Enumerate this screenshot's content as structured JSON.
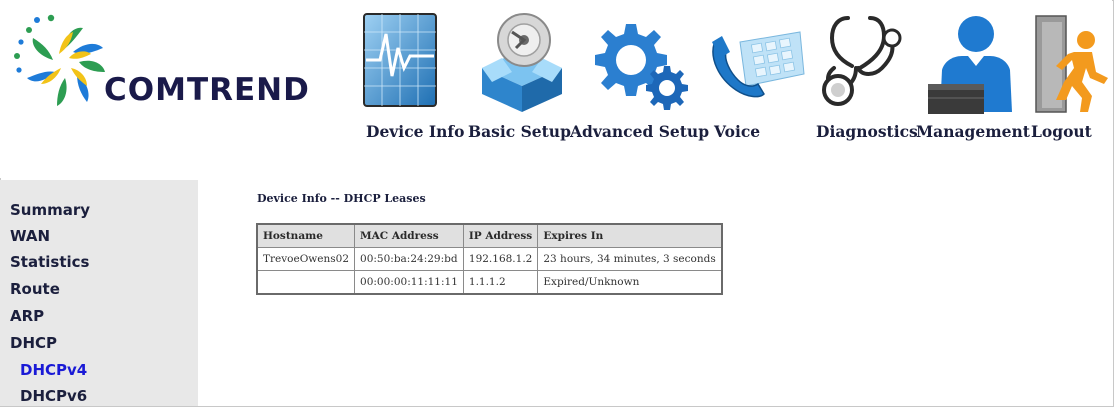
{
  "brand": {
    "name": "COMTREND",
    "colors": {
      "logo_blue": "#1a1a4a",
      "petal_green": "#2d9d52",
      "petal_blue": "#1e7bd8",
      "petal_yellow": "#f2c318"
    }
  },
  "nav": [
    {
      "label": "Device Info",
      "icon": "device-info-icon"
    },
    {
      "label": "Basic Setup",
      "icon": "basic-setup-icon"
    },
    {
      "label": "Advanced Setup",
      "icon": "advanced-setup-icon"
    },
    {
      "label": "Voice",
      "icon": "voice-icon"
    },
    {
      "label": "Diagnostics",
      "icon": "diagnostics-icon"
    },
    {
      "label": "Management",
      "icon": "management-icon"
    },
    {
      "label": "Logout",
      "icon": "logout-icon"
    }
  ],
  "sidebar": {
    "items": [
      {
        "label": "Summary"
      },
      {
        "label": "WAN"
      },
      {
        "label": "Statistics"
      },
      {
        "label": "Route"
      },
      {
        "label": "ARP"
      },
      {
        "label": "DHCP"
      },
      {
        "label": "DHCPv4",
        "active": true
      },
      {
        "label": "DHCPv6"
      }
    ],
    "active_color": "#1a1ad6"
  },
  "page": {
    "title": "Device Info -- DHCP Leases"
  },
  "table": {
    "headers": [
      "Hostname",
      "MAC Address",
      "IP Address",
      "Expires In"
    ],
    "rows": [
      [
        "TrevoeOwens02",
        "00:50:ba:24:29:bd",
        "192.168.1.2",
        "23 hours, 34 minutes, 3 seconds"
      ],
      [
        "",
        "00:00:00:11:11:11",
        "1.1.1.2",
        "Expired/Unknown"
      ]
    ]
  }
}
